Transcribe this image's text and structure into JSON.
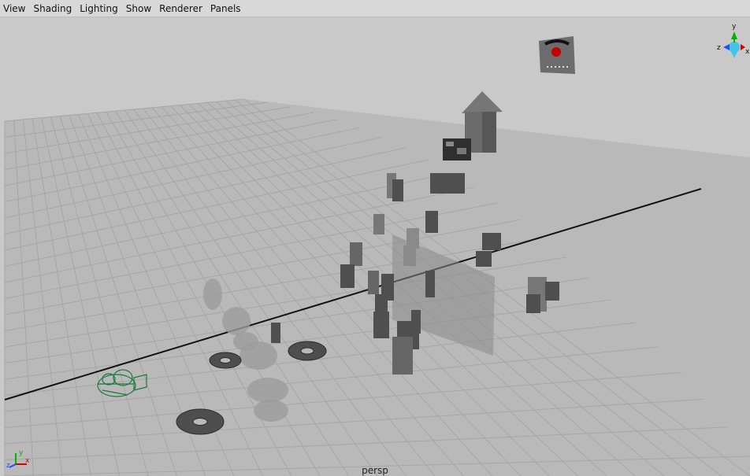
{
  "menubar": {
    "items": [
      "View",
      "Shading",
      "Lighting",
      "Show",
      "Renderer",
      "Panels"
    ]
  },
  "viewport": {
    "camera_label": "persp",
    "view_cube": {
      "axes": [
        "y",
        "z",
        "x"
      ]
    },
    "axis_indicator": {
      "axes": [
        "y",
        "z",
        "x"
      ]
    }
  },
  "colors": {
    "background": "#c9c9c9",
    "grid_plane": "#b9b9b9",
    "grid_lines": "#a6a6a6",
    "axis_line": "#111111",
    "axis_x": "#d40000",
    "axis_y": "#00b400",
    "axis_z": "#1f4fff",
    "camera_wire": "#1a7a3a",
    "gizmo_cyan": "#46c4e8"
  }
}
